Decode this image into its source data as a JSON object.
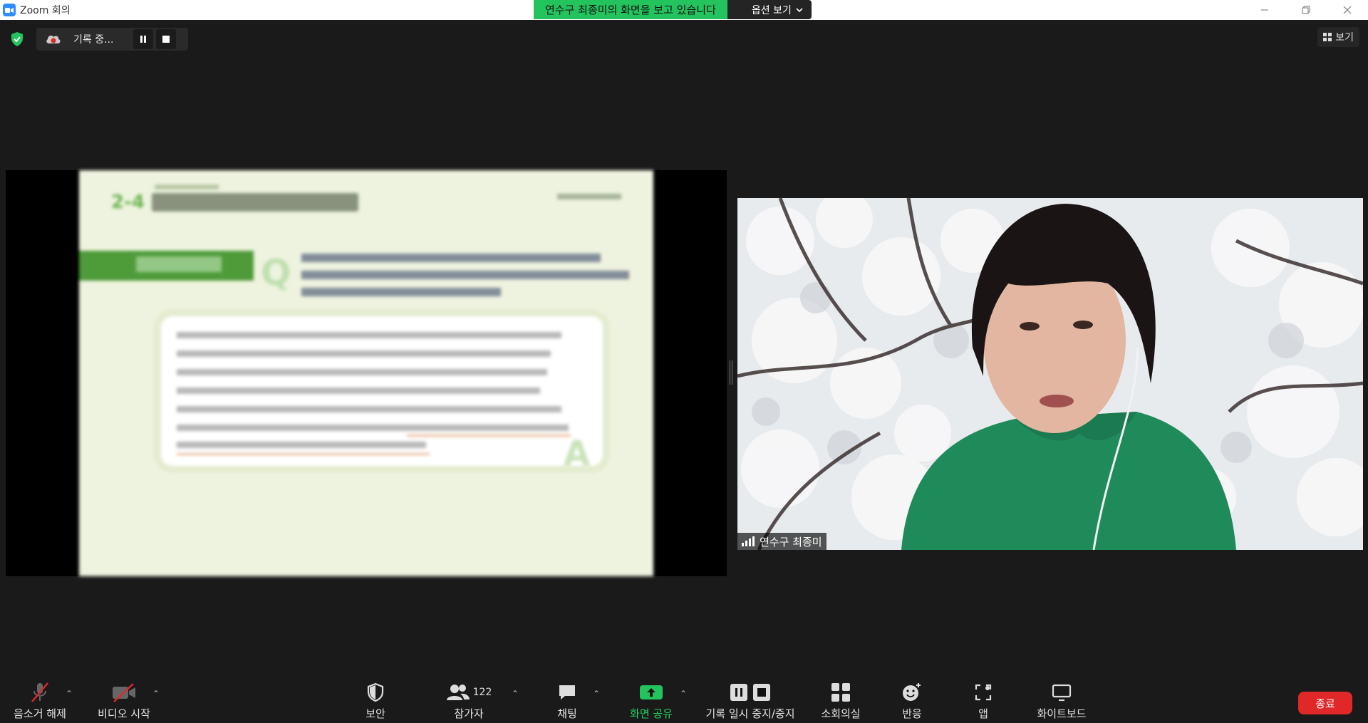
{
  "window": {
    "title": "Zoom 회의",
    "min_icon": "minimize-icon",
    "restore_icon": "restore-icon",
    "close_icon": "close-icon"
  },
  "share_banner": {
    "status_text": "연수구 최종미의 화면을 보고 있습니다",
    "options_label": "옵션 보기",
    "color": "#23c35e"
  },
  "recording": {
    "label": "기록 중...",
    "pause_icon": "pause-icon",
    "stop_icon": "stop-icon"
  },
  "view_button": {
    "label": "보기"
  },
  "shared_slide": {
    "number": "2-4",
    "question_mark": "Q",
    "answer_mark": "A"
  },
  "video": {
    "participant_name": "연수구 최종미"
  },
  "toolbar": {
    "mute_label": "음소거 해제",
    "video_label": "비디오 시작",
    "security_label": "보안",
    "participants_label": "참가자",
    "participants_count": "122",
    "chat_label": "채팅",
    "share_label": "화면 공유",
    "record_label": "기록 일시 중지/중지",
    "breakout_label": "소회의실",
    "reactions_label": "반응",
    "apps_label": "앱",
    "whiteboard_label": "화이트보드",
    "end_label": "종료",
    "end_color": "#e02828",
    "share_color": "#23d160"
  }
}
